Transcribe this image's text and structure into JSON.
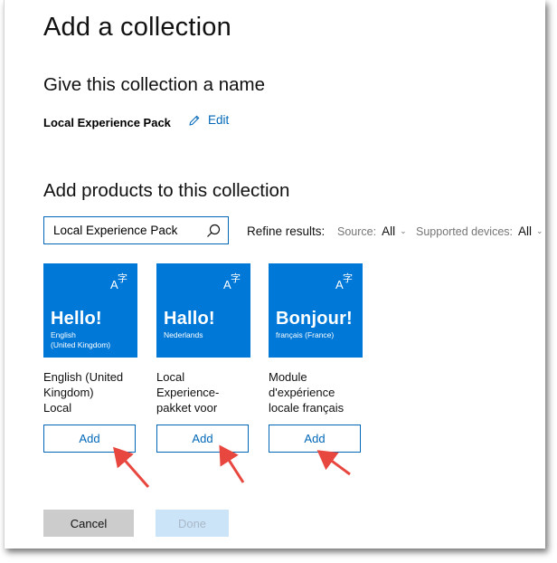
{
  "dialog": {
    "title": "Add a collection",
    "name_section_heading": "Give this collection a name",
    "collection_name": "Local Experience Pack",
    "edit_label": "Edit",
    "products_section_heading": "Add products to this collection"
  },
  "search": {
    "value": "Local Experience Pack",
    "icon": "search-icon"
  },
  "filters": {
    "refine_label": "Refine results:",
    "source": {
      "label": "Source:",
      "value": "All"
    },
    "devices": {
      "label": "Supported devices:",
      "value": "All"
    }
  },
  "products": [
    {
      "tile_title": "Hello!",
      "tile_subtitle": "English\n(United Kingdom)",
      "name": "English (United\nKingdom)\nLocal",
      "add_label": "Add"
    },
    {
      "tile_title": "Hallo!",
      "tile_subtitle": "Nederlands",
      "name": "Local\nExperience-\npakket voor",
      "add_label": "Add"
    },
    {
      "tile_title": "Bonjour!",
      "tile_subtitle": "français (France)",
      "name": "Module\nd'expérience\nlocale français",
      "add_label": "Add"
    }
  ],
  "footer": {
    "cancel_label": "Cancel",
    "done_label": "Done"
  },
  "colors": {
    "accent": "#0067b8",
    "tile": "#0078d7",
    "annotation_arrow": "#e8473f"
  }
}
